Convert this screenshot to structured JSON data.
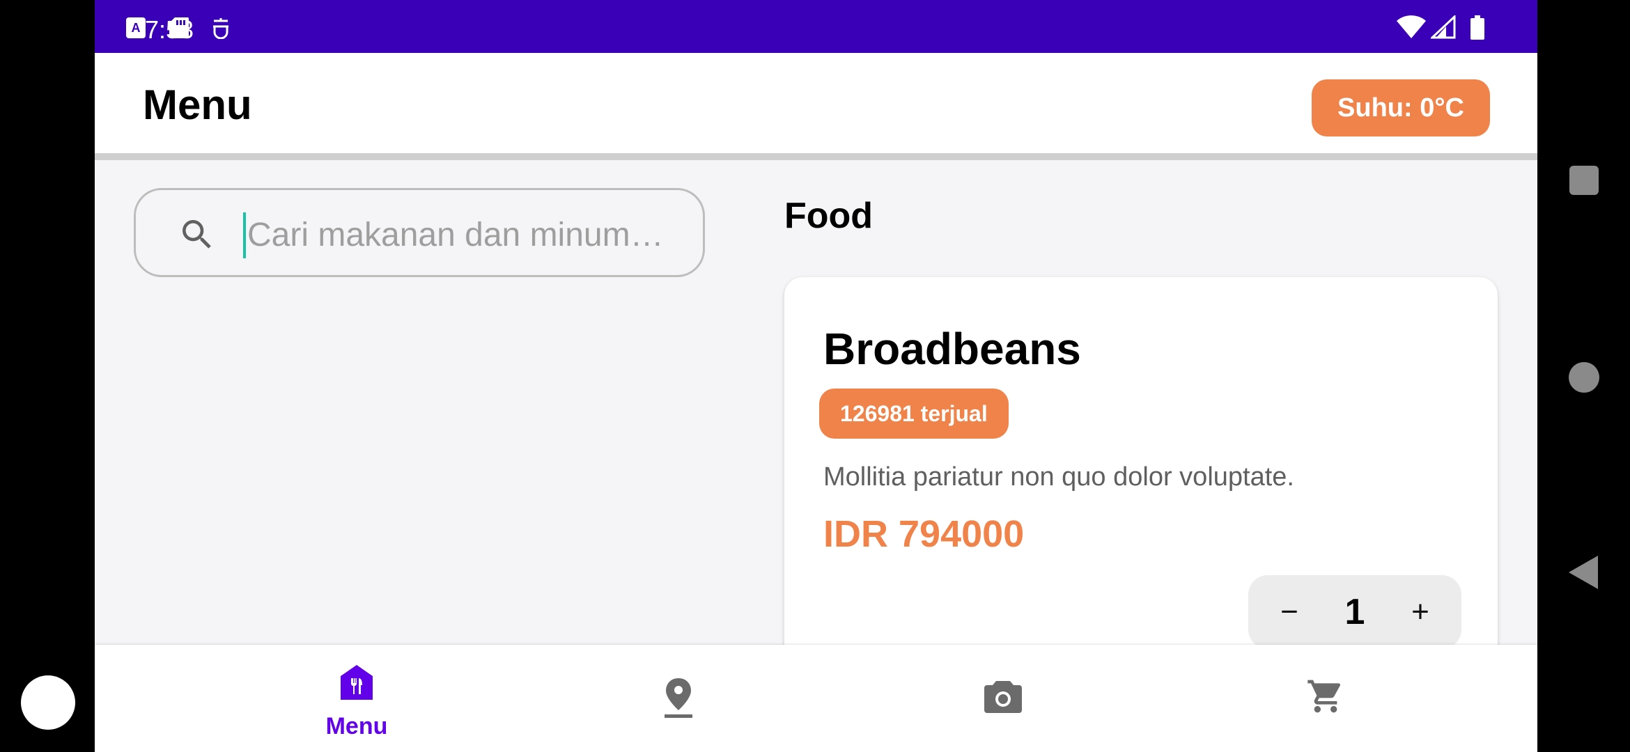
{
  "status_bar": {
    "time": "7:53",
    "left_icons": [
      "autofill-icon",
      "sd-card-icon",
      "assistant-icon"
    ],
    "right_icons": [
      "wifi-icon",
      "signal-icon",
      "battery-icon"
    ]
  },
  "app_bar": {
    "title": "Menu",
    "temperature_label": "Suhu: 0°C"
  },
  "search": {
    "placeholder": "Cari makanan dan minum…",
    "value": ""
  },
  "section": {
    "title": "Food"
  },
  "items": [
    {
      "name": "Broadbeans",
      "sold_label": "126981 terjual",
      "description": "Mollitia pariatur non quo dolor voluptate.",
      "price": "IDR 794000",
      "quantity": "1",
      "minus_label": "−",
      "plus_label": "+"
    }
  ],
  "bottom_nav": {
    "items": [
      {
        "id": "menu",
        "label": "Menu",
        "icon": "restaurant-menu-icon",
        "active": true
      },
      {
        "id": "location",
        "label": "",
        "icon": "location-pin-icon",
        "active": false
      },
      {
        "id": "camera",
        "label": "",
        "icon": "camera-icon",
        "active": false
      },
      {
        "id": "cart",
        "label": "",
        "icon": "cart-icon",
        "active": false
      }
    ]
  },
  "colors": {
    "status_bar": "#3a00b7",
    "accent_orange": "#f0834a",
    "nav_active": "#6200ea",
    "cursor": "#16c3a4"
  }
}
